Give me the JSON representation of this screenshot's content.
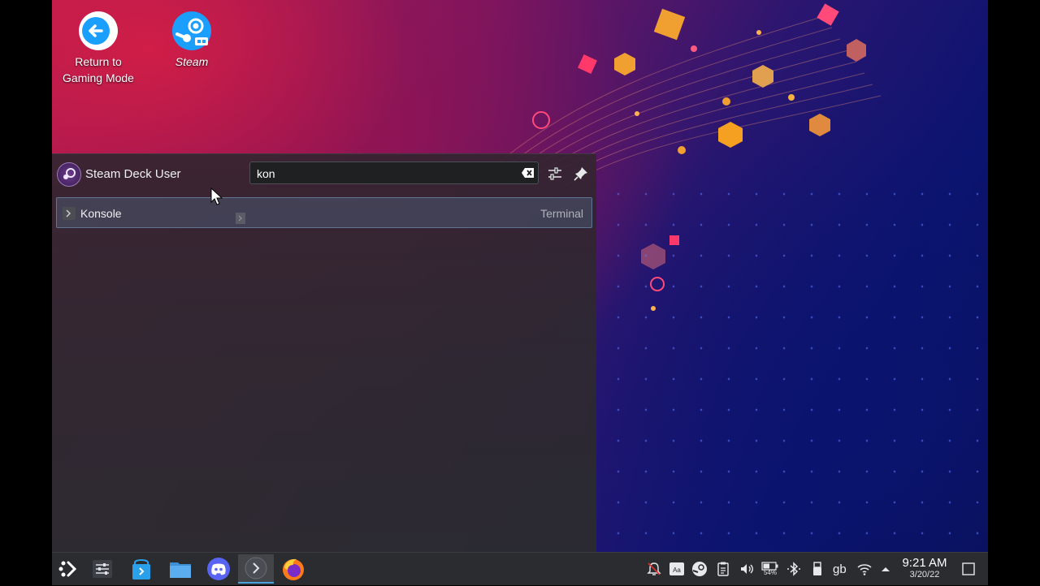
{
  "desktop": {
    "icons": [
      {
        "label_line1": "Return to",
        "label_line2": "Gaming Mode"
      },
      {
        "label": "Steam"
      }
    ]
  },
  "launcher": {
    "user_name": "Steam Deck User",
    "search_value": "kon",
    "results": [
      {
        "name": "Konsole",
        "category": "Terminal"
      }
    ]
  },
  "taskbar": {
    "keyboard_layout": "gb",
    "battery_percent": "54%",
    "clock_time": "9:21 AM",
    "clock_date": "3/20/22"
  },
  "colors": {
    "accent": "#4aa3df",
    "steam_blue": "#1a9fff",
    "selection": "#587696"
  }
}
